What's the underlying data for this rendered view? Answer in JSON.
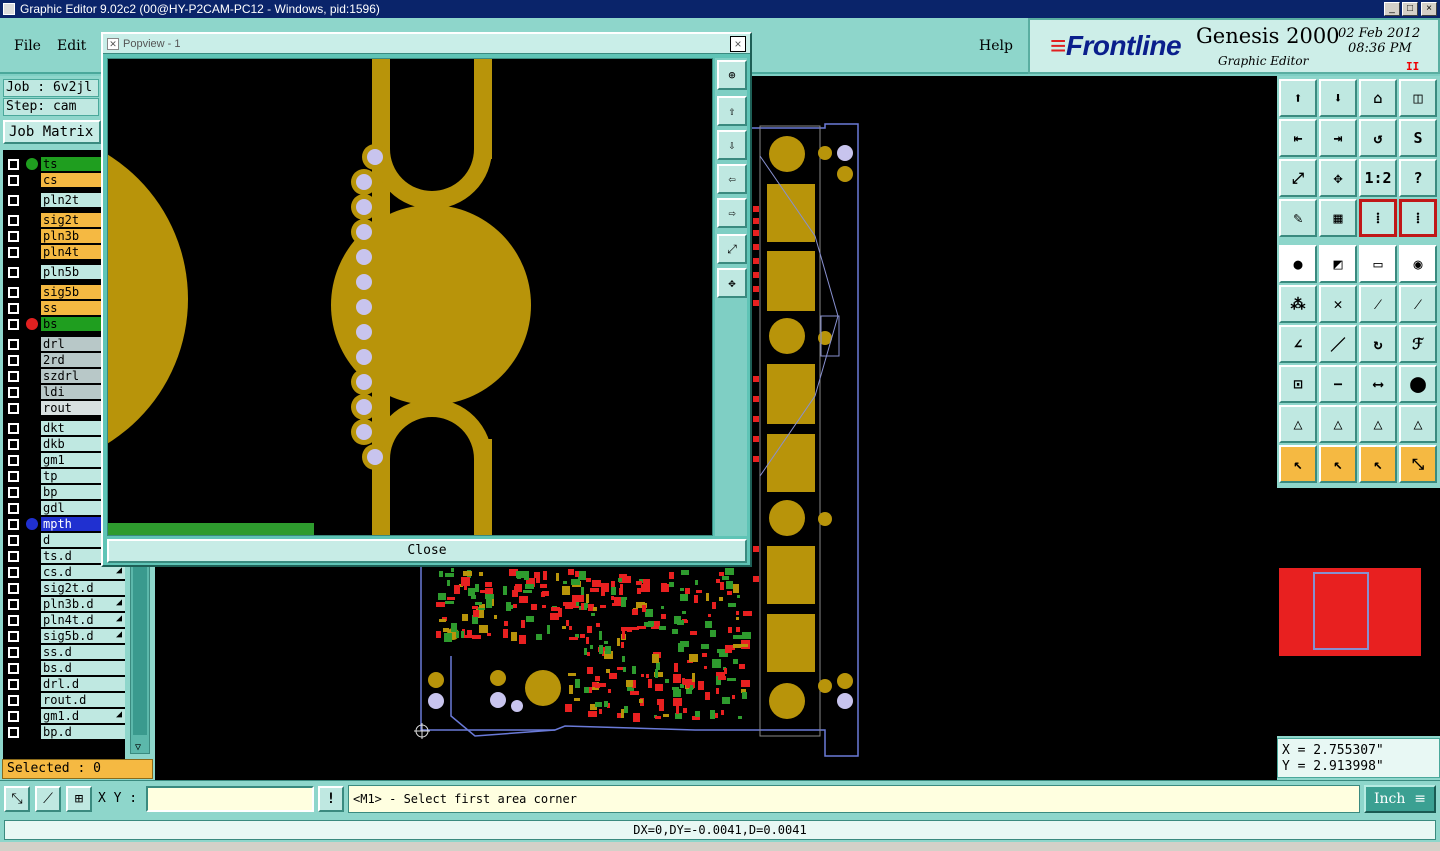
{
  "window": {
    "title": "Graphic Editor 9.02c2 (00@HY-P2CAM-PC12 - Windows, pid:1596)"
  },
  "menu": {
    "file": "File",
    "edit": "Edit",
    "help": "Help"
  },
  "branding": {
    "frontline": "Frontline",
    "product": "Genesis 2000",
    "subtitle": "Graphic Editor",
    "date": "02 Feb 2012",
    "time": "08:36 PM",
    "pause": "II"
  },
  "job": {
    "job_label": "Job : 6v2jl",
    "step_label": "Step: cam",
    "matrix_button": "Job Matrix"
  },
  "layers": [
    {
      "name": "ts",
      "color": "#1f9e1f",
      "marker": "#1f9e1f"
    },
    {
      "name": "cs",
      "color": "#f5b942",
      "marker": ""
    },
    {
      "name": "pln2t",
      "color": "#bfe8e1",
      "marker": "",
      "gap": true
    },
    {
      "name": "sig2t",
      "color": "#f5b942",
      "marker": "",
      "gap": true
    },
    {
      "name": "pln3b",
      "color": "#f5b942",
      "marker": ""
    },
    {
      "name": "pln4t",
      "color": "#f5b942",
      "marker": ""
    },
    {
      "name": "pln5b",
      "color": "#bfe8e1",
      "marker": "",
      "gap": true
    },
    {
      "name": "sig5b",
      "color": "#f5b942",
      "marker": "",
      "gap": true
    },
    {
      "name": "ss",
      "color": "#f5b942",
      "marker": ""
    },
    {
      "name": "bs",
      "color": "#1f9e1f",
      "marker": "#e02020"
    },
    {
      "name": "drl",
      "color": "#b8c8c8",
      "marker": "",
      "gap": true
    },
    {
      "name": "2rd",
      "color": "#b8c8c8",
      "marker": ""
    },
    {
      "name": "szdrl",
      "color": "#b8c8c8",
      "marker": ""
    },
    {
      "name": "ldi",
      "color": "#b8c8c8",
      "marker": ""
    },
    {
      "name": "rout",
      "color": "#d8e0e0",
      "marker": ""
    },
    {
      "name": "dkt",
      "color": "#bfe8e1",
      "marker": "",
      "gap": true
    },
    {
      "name": "dkb",
      "color": "#bfe8e1",
      "marker": ""
    },
    {
      "name": "gm1",
      "color": "#bfe8e1",
      "marker": ""
    },
    {
      "name": "tp",
      "color": "#bfe8e1",
      "marker": ""
    },
    {
      "name": "bp",
      "color": "#bfe8e1",
      "marker": ""
    },
    {
      "name": "gdl",
      "color": "#bfe8e1",
      "marker": ""
    },
    {
      "name": "mpth",
      "color": "#2030d0",
      "marker": "#2030d0",
      "textcolor": "#fff"
    },
    {
      "name": "d",
      "color": "#bfe8e1",
      "marker": ""
    },
    {
      "name": "ts.d",
      "color": "#bfe8e1",
      "marker": ""
    },
    {
      "name": "cs.d",
      "color": "#bfe8e1",
      "marker": "",
      "arrow": true
    },
    {
      "name": "sig2t.d",
      "color": "#bfe8e1",
      "marker": ""
    },
    {
      "name": "pln3b.d",
      "color": "#bfe8e1",
      "marker": "",
      "arrow": true
    },
    {
      "name": "pln4t.d",
      "color": "#bfe8e1",
      "marker": "",
      "arrow": true
    },
    {
      "name": "sig5b.d",
      "color": "#bfe8e1",
      "marker": "",
      "arrow": true
    },
    {
      "name": "ss.d",
      "color": "#bfe8e1",
      "marker": ""
    },
    {
      "name": "bs.d",
      "color": "#bfe8e1",
      "marker": ""
    },
    {
      "name": "drl.d",
      "color": "#bfe8e1",
      "marker": ""
    },
    {
      "name": "rout.d",
      "color": "#bfe8e1",
      "marker": ""
    },
    {
      "name": "gm1.d",
      "color": "#bfe8e1",
      "marker": "",
      "arrow": true
    },
    {
      "name": "bp.d",
      "color": "#bfe8e1",
      "marker": ""
    }
  ],
  "selected": "Selected : 0",
  "popview": {
    "title": "Popview - 1",
    "close_label": "Close"
  },
  "coords": {
    "x": "X = 2.755307\"",
    "y": "Y = 2.913998\""
  },
  "bottom": {
    "xy_label": "X Y :",
    "xy_value": "",
    "prompt": "<M1> - Select first area corner",
    "unit": "Inch",
    "status": "DX=0,DY=-0.0041,D=0.0041",
    "alert_button": "!"
  },
  "colors": {
    "copper": "#b8940a",
    "pad_lilac": "#c8c4ee",
    "smd_red": "#e82020",
    "smd_green": "#2e9b2e",
    "panel": "#8ed6cb"
  }
}
